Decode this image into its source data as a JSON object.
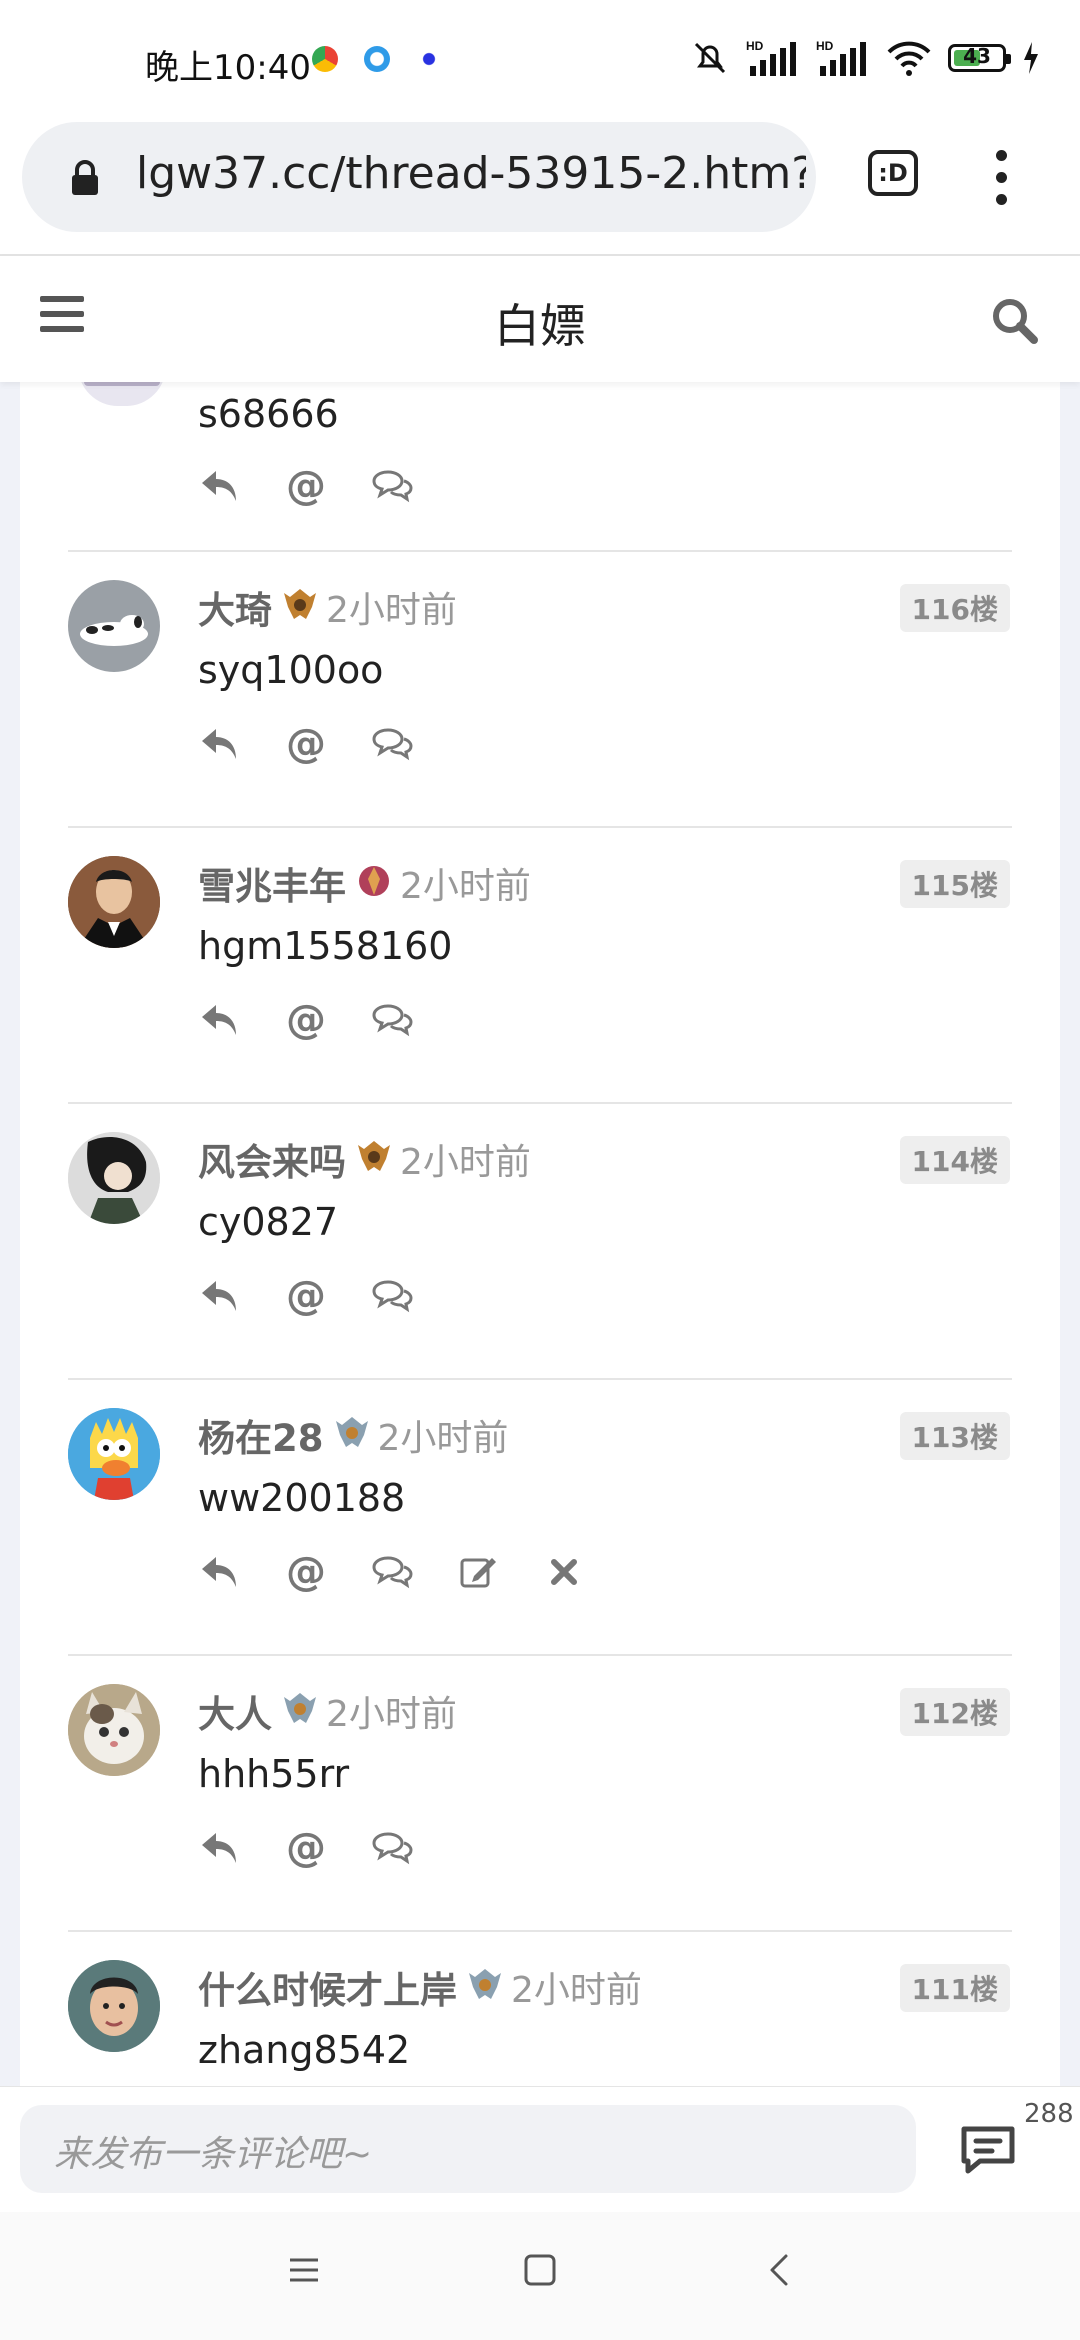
{
  "status_bar": {
    "time": "晚上10:40",
    "battery": "43",
    "app_icons": [
      "chrome-icon",
      "browser-icon",
      "baidu-icon"
    ],
    "status_icons": [
      "mute-icon",
      "signal-hd-icon",
      "signal-hd-icon",
      "wifi-icon",
      "battery-icon",
      "charging-icon"
    ]
  },
  "browser": {
    "url": "lgw37.cc/thread-53915-2.htm?",
    "tab_label": ":D"
  },
  "site": {
    "title": "白嫖"
  },
  "partial_post": {
    "content": "s68666"
  },
  "posts": [
    {
      "username": "大琦",
      "time": "2小时前",
      "floor": "116楼",
      "content": "syq100oo",
      "avatar": "snoopy",
      "rank_color": "#c08030"
    },
    {
      "username": "雪兆丰年",
      "time": "2小时前",
      "floor": "115楼",
      "content": "hgm1558160",
      "avatar": "man-suit",
      "rank_color": "#b0405a"
    },
    {
      "username": "风会来吗",
      "time": "2小时前",
      "floor": "114楼",
      "content": "cy0827",
      "avatar": "anime",
      "rank_color": "#c08030"
    },
    {
      "username": "杨在28",
      "time": "2小时前",
      "floor": "113楼",
      "content": "ww200188",
      "avatar": "bart",
      "rank_color": "#8aa0b0",
      "editable": true
    },
    {
      "username": "大人",
      "time": "2小时前",
      "floor": "112楼",
      "content": "hhh55rr",
      "avatar": "cat",
      "rank_color": "#8aa0b0"
    },
    {
      "username": "什么时候才上岸",
      "time": "2小时前",
      "floor": "111楼",
      "content": "zhang8542",
      "avatar": "man-face",
      "rank_color": "#8aa0b0"
    }
  ],
  "comment_bar": {
    "placeholder": "来发布一条评论吧~",
    "count": "288"
  },
  "colors": {
    "accent_bg": "#f0f2f8",
    "floor_badge_bg": "#eeeeee",
    "username": "#666666",
    "muted": "#999999"
  }
}
